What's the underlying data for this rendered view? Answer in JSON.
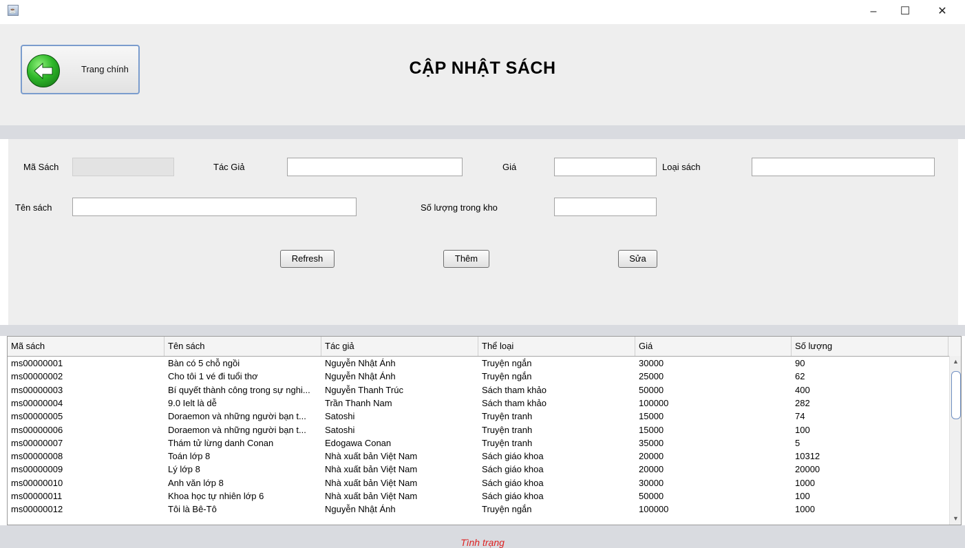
{
  "window": {
    "app_icon": "java-cup-icon",
    "minimize_glyph": "–",
    "maximize_glyph": "☐",
    "close_glyph": "✕"
  },
  "header": {
    "home_label": "Trang chính",
    "home_icon": "back-arrow-icon",
    "title": "CẬP NHẬT SÁCH"
  },
  "form": {
    "ma_sach_label": "Mã Sách",
    "ma_sach_value": "",
    "tac_gia_label": "Tác Giả",
    "tac_gia_value": "",
    "gia_label": "Giá",
    "gia_value": "",
    "loai_sach_label": "Loại sách",
    "loai_sach_value": "",
    "ten_sach_label": "Tên sách",
    "ten_sach_value": "",
    "so_luong_label": "Số lượng trong kho",
    "so_luong_value": "",
    "refresh_label": "Refresh",
    "them_label": "Thêm",
    "sua_label": "Sửa"
  },
  "table": {
    "columns": [
      "Mã sách",
      "Tên sách",
      "Tác giả",
      "Thể loại",
      "Giá",
      "Số lượng"
    ],
    "rows": [
      [
        "ms00000001",
        "Bàn có 5 chỗ ngồi",
        "Nguyễn Nhật Ánh",
        "Truyện ngắn",
        "30000",
        "90"
      ],
      [
        "ms00000002",
        "Cho tôi 1 vé đi tuổi thơ",
        "Nguyễn Nhật Ánh",
        "Truyện ngắn",
        "25000",
        "62"
      ],
      [
        "ms00000003",
        "Bí quyết thành công trong sự nghi...",
        "Nguyễn Thanh Trúc",
        "Sách tham khảo",
        "50000",
        "400"
      ],
      [
        "ms00000004",
        "9.0 Ielt là dễ",
        "Trần Thanh Nam",
        "Sách tham khảo",
        "100000",
        "282"
      ],
      [
        "ms00000005",
        "Doraemon và những người bạn t...",
        "Satoshi",
        "Truyện tranh",
        "15000",
        "74"
      ],
      [
        "ms00000006",
        "Doraemon và những người bạn t...",
        "Satoshi",
        "Truyện tranh",
        "15000",
        "100"
      ],
      [
        "ms00000007",
        "Thám tử lừng danh Conan",
        "Edogawa Conan",
        "Truyện tranh",
        "35000",
        "5"
      ],
      [
        "ms00000008",
        "Toán lớp 8",
        "Nhà xuất bản Việt Nam",
        "Sách giáo khoa",
        "20000",
        "10312"
      ],
      [
        "ms00000009",
        "Lý lớp 8",
        "Nhà xuất bản Việt Nam",
        "Sách giáo khoa",
        "20000",
        "20000"
      ],
      [
        "ms00000010",
        "Anh văn lớp 8",
        "Nhà xuất bản Việt Nam",
        "Sách giáo khoa",
        "30000",
        "1000"
      ],
      [
        "ms00000011",
        "Khoa học tự nhiên lớp 6",
        "Nhà xuất bản Việt Nam",
        "Sách giáo khoa",
        "50000",
        "100"
      ],
      [
        "ms00000012",
        "Tôi là Bê-Tô",
        "Nguyễn Nhật Ánh",
        "Truyện ngắn",
        "100000",
        "1000"
      ]
    ]
  },
  "status": {
    "text": "Tình trạng",
    "color": "#dd2222"
  }
}
